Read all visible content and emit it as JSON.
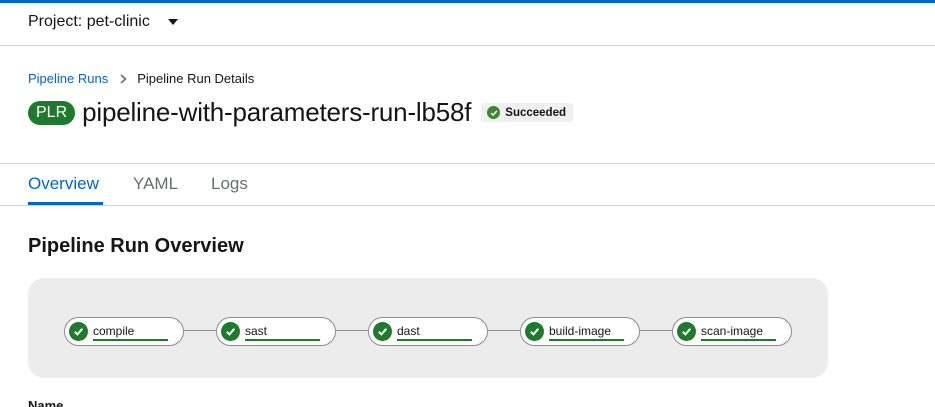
{
  "project": {
    "label": "Project: pet-clinic"
  },
  "breadcrumb": {
    "parent": "Pipeline Runs",
    "current": "Pipeline Run Details"
  },
  "header": {
    "badge": "PLR",
    "title": "pipeline-with-parameters-run-lb58f",
    "status": "Succeeded",
    "status_color": "#3e8635"
  },
  "tabs": [
    {
      "label": "Overview"
    },
    {
      "label": "YAML"
    },
    {
      "label": "Logs"
    }
  ],
  "overview": {
    "title": "Pipeline Run Overview",
    "tasks": [
      {
        "label": "compile",
        "status": "succeeded"
      },
      {
        "label": "sast",
        "status": "succeeded"
      },
      {
        "label": "dast",
        "status": "succeeded"
      },
      {
        "label": "build-image",
        "status": "succeeded"
      },
      {
        "label": "scan-image",
        "status": "succeeded"
      }
    ],
    "name_label": "Name"
  },
  "colors": {
    "accent": "#0066cc",
    "success": "#1f7a2e"
  }
}
